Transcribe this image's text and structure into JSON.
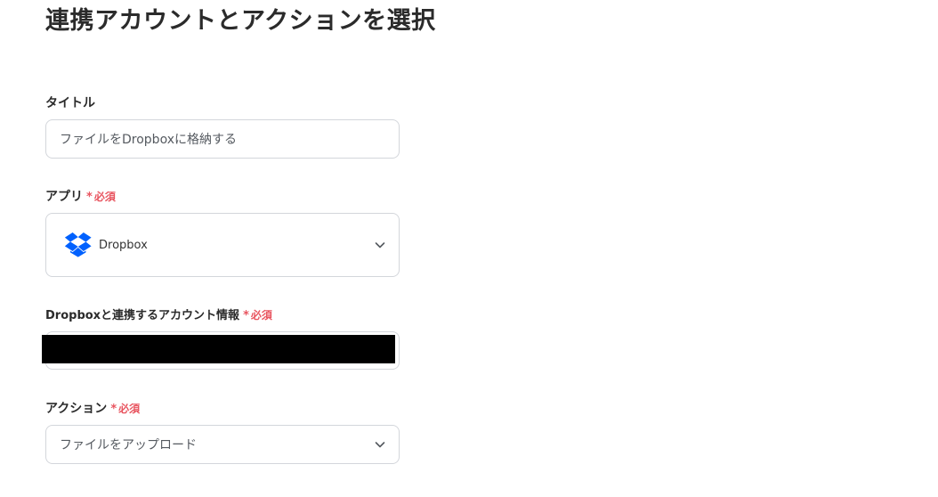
{
  "page": {
    "title": "連携アカウントとアクションを選択"
  },
  "required_marker": {
    "star": "*",
    "text": "必須",
    "color": "#e8545f"
  },
  "fields": {
    "title": {
      "label": "タイトル",
      "value": "ファイルをDropboxに格納する"
    },
    "app": {
      "label": "アプリ",
      "selected": "Dropbox",
      "icon": "dropbox-logo-icon",
      "brand_color": "#0061fe"
    },
    "account": {
      "label": "Dropboxと連携するアカウント情報"
    },
    "action": {
      "label": "アクション",
      "selected": "ファイルをアップロード"
    }
  }
}
